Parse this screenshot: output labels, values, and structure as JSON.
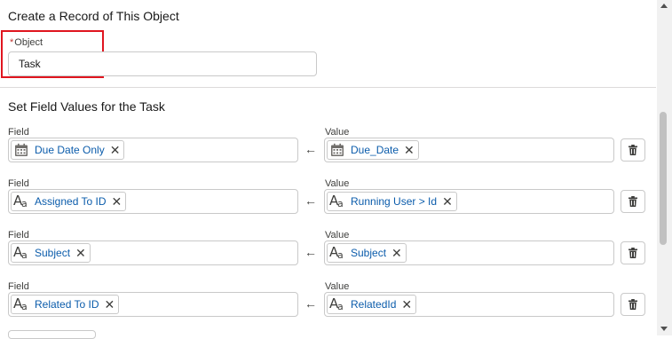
{
  "create": {
    "title": "Create a Record of This Object",
    "object_required_mark": "*",
    "object_label": "Object",
    "object_value": "Task"
  },
  "field_values": {
    "title": "Set Field Values for the Task",
    "field_col_label": "Field",
    "value_col_label": "Value",
    "rows": [
      {
        "field": "Due Date Only",
        "field_icon": "calendar-icon",
        "value": "Due_Date",
        "value_icon": "calendar-icon"
      },
      {
        "field": "Assigned To ID",
        "field_icon": "text-icon",
        "value": "Running User > Id",
        "value_icon": "text-icon"
      },
      {
        "field": "Subject",
        "field_icon": "text-icon",
        "value": "Subject",
        "value_icon": "text-icon"
      },
      {
        "field": "Related To ID",
        "field_icon": "text-icon",
        "value": "RelatedId",
        "value_icon": "text-icon"
      }
    ]
  },
  "glyphs": {
    "remove": "✕",
    "arrow": "←"
  },
  "colors": {
    "pill_text": "#0b5cab",
    "highlight": "#e0151f",
    "required": "#c23934"
  }
}
